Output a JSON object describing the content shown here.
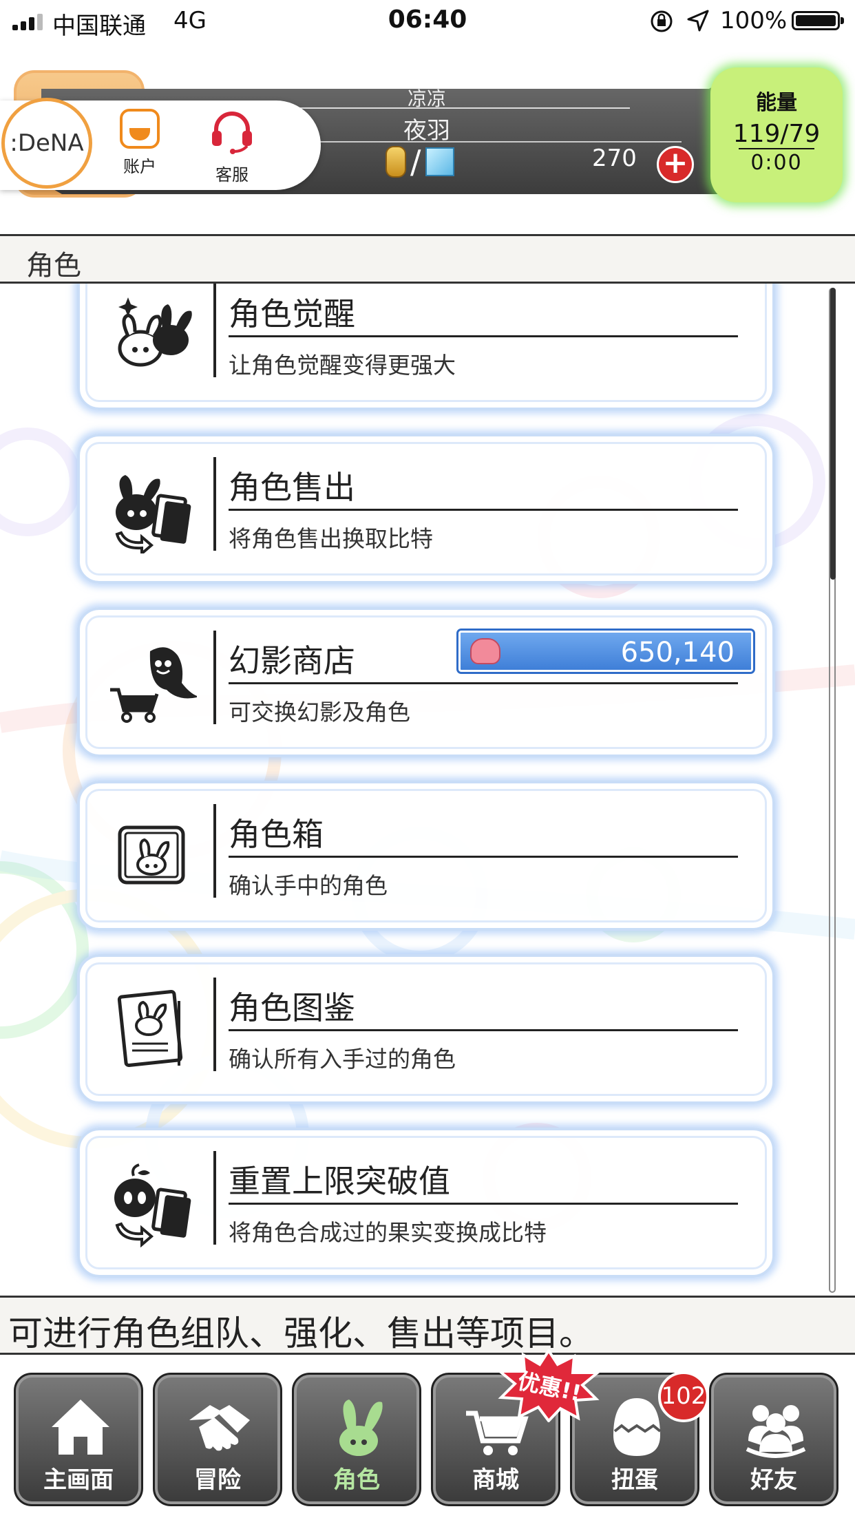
{
  "status_bar": {
    "carrier": "中国联通",
    "network": "4G",
    "time": "06:40",
    "battery": "100%"
  },
  "header": {
    "player_name_top": "凉凉",
    "player_name": "夜羽",
    "currency_count": "270",
    "dena_logo": ":DeNA",
    "account_label": "账户",
    "support_label": "客服",
    "energy_title": "能量",
    "energy_value": "119/79",
    "energy_timer": "0:00"
  },
  "section_title": "角色",
  "menu": [
    {
      "title": "角色觉醒",
      "desc": "让角色觉醒变得更强大",
      "icon": "rabbit-awaken-icon"
    },
    {
      "title": "角色售出",
      "desc": "将角色售出换取比特",
      "icon": "rabbit-sell-icon"
    },
    {
      "title": "幻影商店",
      "desc": "可交换幻影及角色",
      "icon": "ghost-cart-icon",
      "phantom_count": "650,140"
    },
    {
      "title": "角色箱",
      "desc": "确认手中的角色",
      "icon": "character-box-icon"
    },
    {
      "title": "角色图鉴",
      "desc": "确认所有入手过的角色",
      "icon": "character-book-icon"
    },
    {
      "title": "重置上限突破值",
      "desc": "将角色合成过的果实变换成比特",
      "icon": "fruit-exchange-icon"
    }
  ],
  "info_text": "可进行角色组队、强化、售出等项目。",
  "nav": {
    "tabs": [
      "主画面",
      "冒险",
      "角色",
      "商城",
      "扭蛋",
      "好友"
    ],
    "active": "角色",
    "gacha_badge": "102",
    "promo": "优惠!!"
  }
}
